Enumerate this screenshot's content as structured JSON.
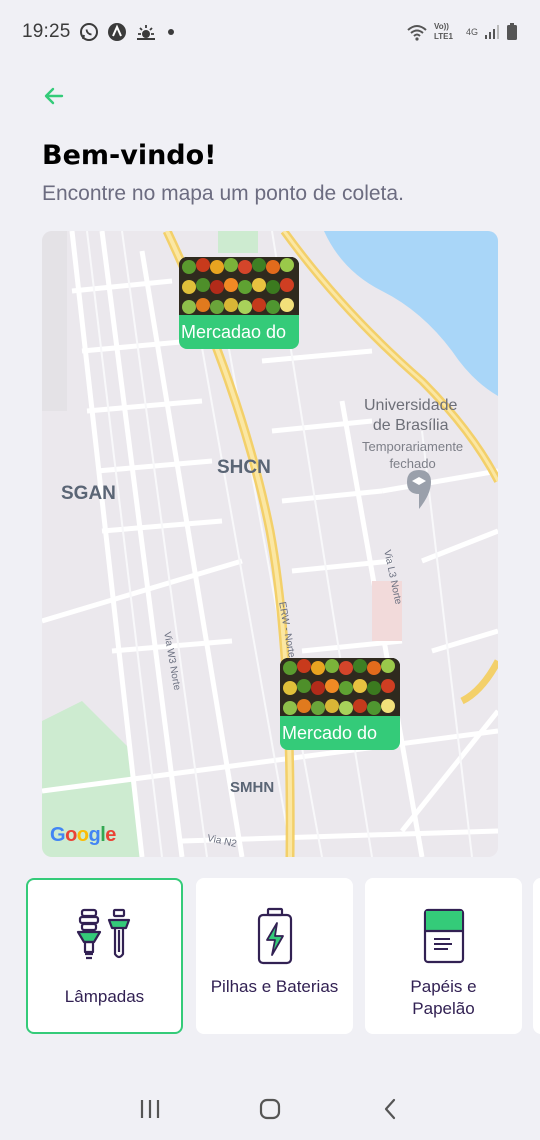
{
  "status_bar": {
    "time": "19:25",
    "icons": [
      "whatsapp-icon",
      "app-a-icon",
      "weather-icon",
      "dot-icon"
    ],
    "network": {
      "volte": "Vo)) LTE1",
      "gen": "4G"
    }
  },
  "header": {
    "title": "Bem-vindo!",
    "subtitle": "Encontre no mapa um ponto de coleta."
  },
  "map": {
    "area_labels": [
      "SGAN",
      "SHCN",
      "SMHN"
    ],
    "road_labels": [
      "Via W3 Norte",
      "ERW - Norte",
      "Via L3 Norte",
      "Via N2"
    ],
    "poi": {
      "name_line1": "Universidade",
      "name_line2": "de Brasília",
      "status_line1": "Temporariamente",
      "status_line2": "fechado"
    },
    "attribution": "Google",
    "markers": [
      {
        "caption": "Mercadao do"
      },
      {
        "caption": "Mercado do"
      }
    ]
  },
  "items": [
    {
      "label": "Lâmpadas",
      "icon": "lamps-icon",
      "selected": true
    },
    {
      "label": "Pilhas e Baterias",
      "icon": "battery-icon",
      "selected": false
    },
    {
      "label": "Papéis e Papelão",
      "icon": "paper-icon",
      "selected": false
    }
  ],
  "colors": {
    "accent": "#34cb79",
    "text": "#322153",
    "muted": "#6c6c80",
    "background": "#f0f0f5"
  },
  "nav": [
    "recents-icon",
    "home-icon",
    "back-nav-icon"
  ]
}
